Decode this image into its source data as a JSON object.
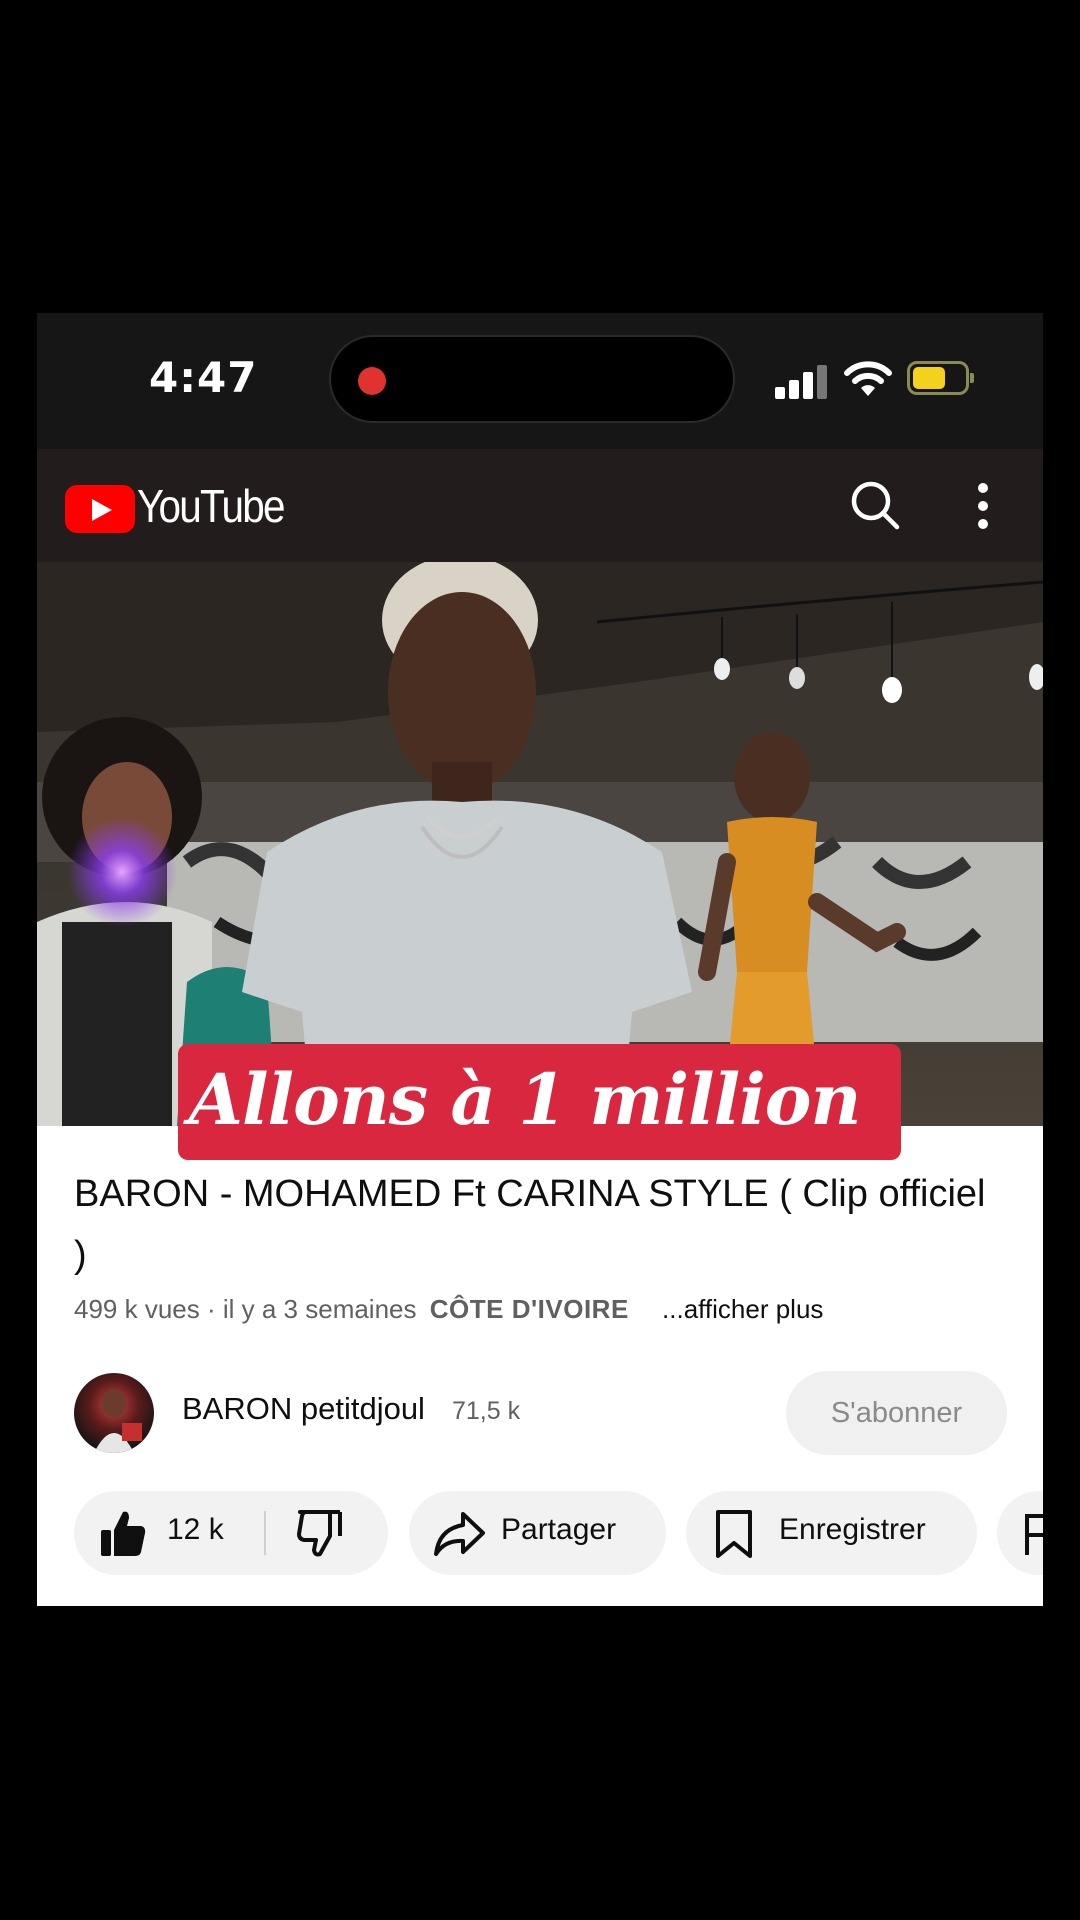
{
  "status_bar": {
    "time": "4:47"
  },
  "header": {
    "logo_text": "YouTube"
  },
  "video": {
    "overlay_text": "Allons à 1 million"
  },
  "info": {
    "title": "BARON - MOHAMED Ft CARINA STYLE ( Clip officiel )",
    "views": "499 k vues",
    "age": "· il y a 3 semaines",
    "location": "CÔTE D'IVOIRE",
    "show_more": "...afficher plus"
  },
  "channel": {
    "name": "BARON petitdjoul",
    "subscribers": "71,5 k",
    "subscribe_label": "S'abonner"
  },
  "actions": {
    "likes": "12 k",
    "share_label": "Partager",
    "save_label": "Enregistrer"
  },
  "colors": {
    "brand_red": "#ff0000",
    "banner_red": "#d8273e",
    "battery_yellow": "#f2d21c",
    "record_red": "#e0322e"
  },
  "icons": [
    "record-icon",
    "signal-icon",
    "wifi-icon",
    "battery-icon",
    "youtube-logo-icon",
    "search-icon",
    "more-vert-icon",
    "thumbs-up-icon",
    "thumbs-down-icon",
    "share-icon",
    "bookmark-icon"
  ]
}
